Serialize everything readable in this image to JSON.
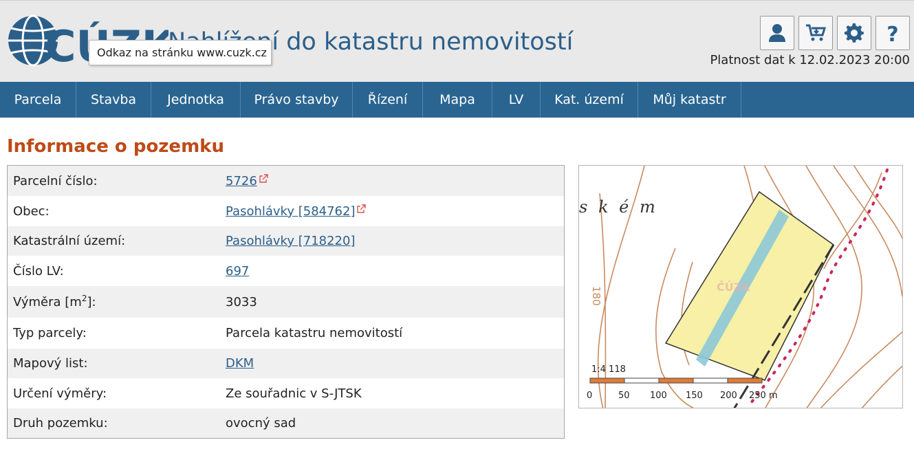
{
  "header": {
    "logo_text": "CÚZK",
    "title": "Nahlížení do katastru nemovitostí",
    "tooltip": "Odkaz na stránku www.cuzk.cz",
    "validity": "Platnost dat k 12.02.2023 20:00",
    "buttons": [
      {
        "icon": "user-icon"
      },
      {
        "icon": "cart-icon"
      },
      {
        "icon": "gear-icon"
      },
      {
        "icon": "help-icon"
      }
    ]
  },
  "nav": {
    "items": [
      {
        "label": "Parcela"
      },
      {
        "label": "Stavba"
      },
      {
        "label": "Jednotka"
      },
      {
        "label": "Právo stavby"
      },
      {
        "label": "Řízení"
      },
      {
        "label": "Mapa"
      },
      {
        "label": "LV"
      },
      {
        "label": "Kat. území"
      },
      {
        "label": "Můj katastr"
      }
    ]
  },
  "page_title": "Informace o pozemku",
  "info": {
    "parcel_number": {
      "label": "Parcelní číslo:",
      "value": "5726"
    },
    "municipality": {
      "label": "Obec:",
      "value": "Pasohlávky [584762]"
    },
    "cadastral_area": {
      "label": "Katastrální území:",
      "value": "Pasohlávky [718220]"
    },
    "lv_number": {
      "label": "Číslo LV:",
      "value": "697"
    },
    "area": {
      "label_prefix": "Výměra [m",
      "label_sup": "2",
      "label_suffix": "]:",
      "value": "3033"
    },
    "parcel_type": {
      "label": "Typ parcely:",
      "value": "Parcela katastru nemovitostí"
    },
    "map_sheet": {
      "label": "Mapový list:",
      "value": "DKM"
    },
    "area_method": {
      "label": "Určení výměry:",
      "value": "Ze souřadnic v S-JTSK"
    },
    "land_type": {
      "label": "Druh pozemku:",
      "value": "ovocný sad"
    }
  },
  "map": {
    "place_name": "s k é m",
    "contour_label": "180",
    "watermark": "ČÚZK",
    "scale_ratio": "1:4 118",
    "scale_ticks": [
      "0",
      "50",
      "100",
      "150",
      "200",
      "250 m"
    ],
    "colors": {
      "parcel_fill": "#f7f0a6",
      "stream": "#8cc8d8",
      "contour": "#c98a5e",
      "scalebar_orange": "#e07b39",
      "boundary_dots": "#c8285a"
    }
  }
}
